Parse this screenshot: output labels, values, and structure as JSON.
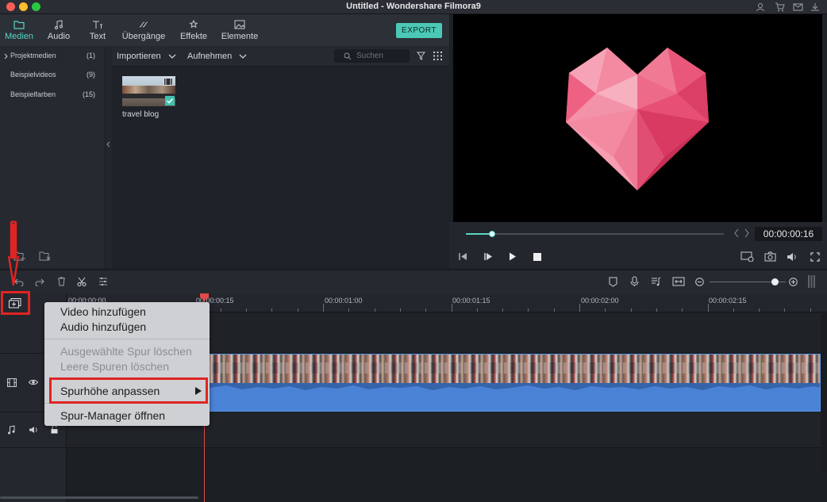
{
  "window": {
    "title": "Untitled - Wondershare Filmora9",
    "traffic_colors": [
      "#fc5f57",
      "#fdbc2e",
      "#2ac840"
    ]
  },
  "tabs": [
    {
      "label": "Medien",
      "icon": "folder-icon",
      "active": true
    },
    {
      "label": "Audio",
      "icon": "music-note-icon"
    },
    {
      "label": "Text",
      "icon": "text-icon"
    },
    {
      "label": "Übergänge",
      "icon": "transition-icon"
    },
    {
      "label": "Effekte",
      "icon": "effects-icon"
    },
    {
      "label": "Elemente",
      "icon": "image-icon"
    }
  ],
  "export_label": "EXPORT",
  "sidebar": {
    "items": [
      {
        "label": "Projektmedien",
        "count": "(1)"
      },
      {
        "label": "Beispielvideos",
        "count": "(9)"
      },
      {
        "label": "Beispielfarben",
        "count": "(15)"
      }
    ]
  },
  "media": {
    "import_label": "Importieren",
    "record_label": "Aufnehmen",
    "search_placeholder": "Suchen",
    "clip_name": "travel blog"
  },
  "preview": {
    "timecode": "00:00:00:16",
    "progress": 0.1
  },
  "timeline": {
    "ruler": [
      "00:00:00:00",
      "00:00:00:15",
      "00:00:01:00",
      "00:00:01:15",
      "00:00:02:00",
      "00:00:02:15"
    ],
    "zoom_level": 0.85
  },
  "context_menu": {
    "add_video": "Video hinzufügen",
    "add_audio": "Audio hinzufügen",
    "delete_selected": "Ausgewählte Spur löschen",
    "delete_empty": "Leere Spuren löschen",
    "adjust_height": "Spurhöhe anpassen",
    "open_manager": "Spur-Manager öffnen"
  },
  "colors": {
    "accent": "#5ad3c6",
    "highlight": "#e02424",
    "audio_wave": "#4a82d6"
  }
}
